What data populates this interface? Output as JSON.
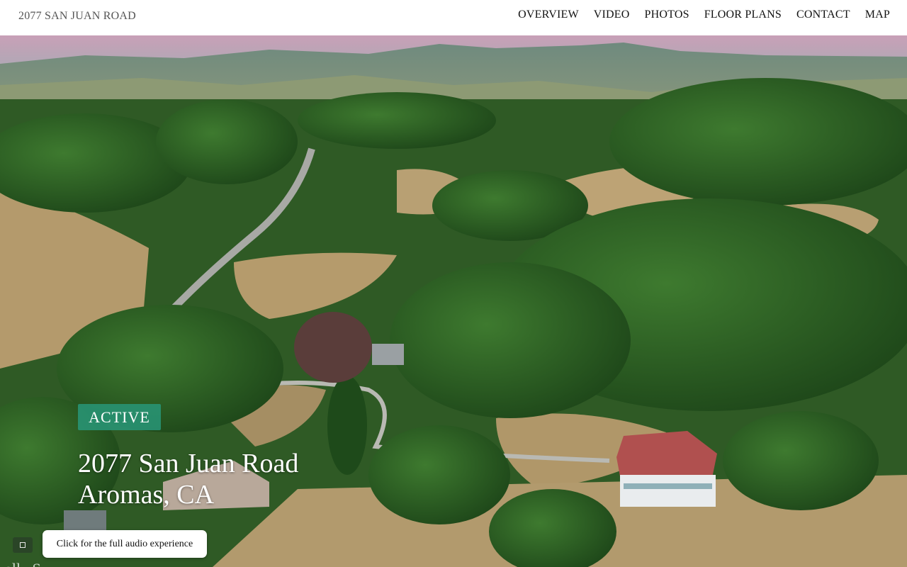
{
  "header": {
    "site_title": "2077 SAN JUAN ROAD",
    "nav": [
      {
        "label": "OVERVIEW"
      },
      {
        "label": "VIDEO"
      },
      {
        "label": "PHOTOS"
      },
      {
        "label": "FLOOR PLANS"
      },
      {
        "label": "CONTACT"
      },
      {
        "label": "MAP"
      }
    ]
  },
  "hero": {
    "status_badge": "ACTIVE",
    "address_line1": "2077 San Juan Road",
    "address_line2": "Aromas, CA",
    "background_text": "ually S",
    "audio_button_label": "Click for the full audio experience"
  },
  "colors": {
    "badge": "#28967a",
    "forest": "#2f5a25",
    "dry_grass": "#b49a6c",
    "roof": "#b0504f"
  }
}
